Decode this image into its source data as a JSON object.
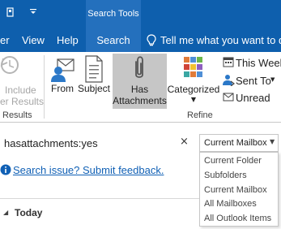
{
  "title_bar": {
    "context_group": "Search Tools"
  },
  "ribbon_tabs": [
    {
      "label": "er",
      "active": false
    },
    {
      "label": "View",
      "active": false
    },
    {
      "label": "Help",
      "active": false
    },
    {
      "label": "Search",
      "active": true
    },
    {
      "label": "Tell me what you want to do",
      "active": false
    }
  ],
  "ribbon": {
    "include_results": {
      "line1": "Include",
      "line2": "er Results",
      "disabled": true
    },
    "group_results_label": "Results",
    "from_label": "From",
    "subject_label": "Subject",
    "has_attachments": {
      "line1": "Has",
      "line2": "Attachments",
      "selected": true
    },
    "categorized_label": "Categorized",
    "this_week_label": "This Week",
    "sent_to_label": "Sent To",
    "unread_label": "Unread",
    "group_refine_label": "Refine"
  },
  "search": {
    "query": "hasattachments:yes",
    "clear_icon": "×",
    "scope_selected": "Current Mailbox",
    "scope_options": [
      "Current Folder",
      "Subfolders",
      "Current Mailbox",
      "All Mailboxes",
      "All Outlook Items"
    ]
  },
  "info": {
    "link_text": "Search issue? Submit feedback."
  },
  "list": {
    "group_label": "Today"
  },
  "colors": {
    "accent": "#0e5fad",
    "active_tab": "#2470bd",
    "link": "#1060b5",
    "selected_button": "#c6c6c6"
  }
}
